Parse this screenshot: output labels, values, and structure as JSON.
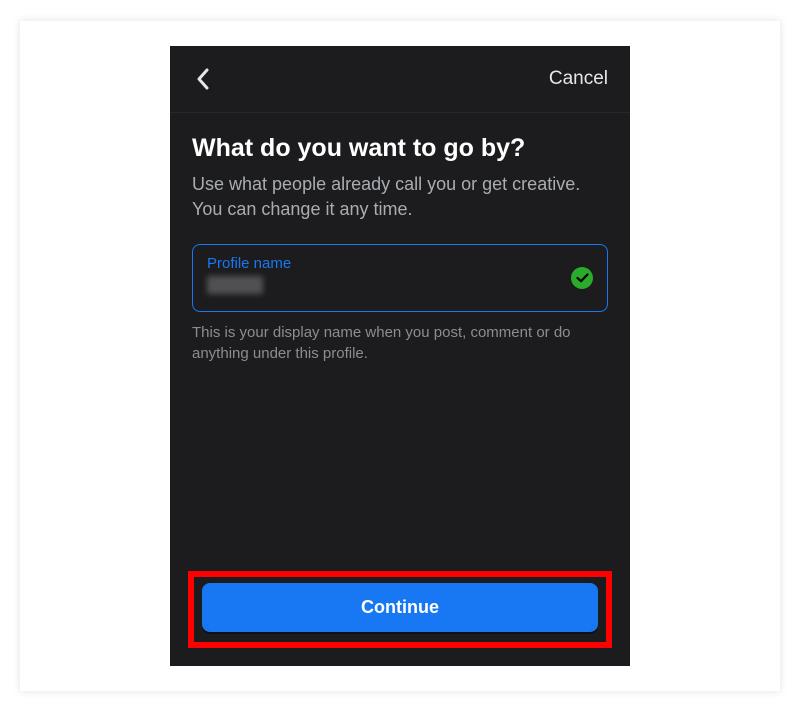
{
  "header": {
    "cancel_label": "Cancel"
  },
  "main": {
    "heading": "What do you want to go by?",
    "subheading": "Use what people already call you or get creative. You can change it any time.",
    "input": {
      "label": "Profile name",
      "value": ""
    },
    "help_text": "This is your display name when you post, comment or do anything under this profile."
  },
  "footer": {
    "continue_label": "Continue"
  },
  "colors": {
    "accent": "#1877f2",
    "success": "#2aab2a",
    "background": "#1c1c1e",
    "highlight": "#ff0000"
  }
}
